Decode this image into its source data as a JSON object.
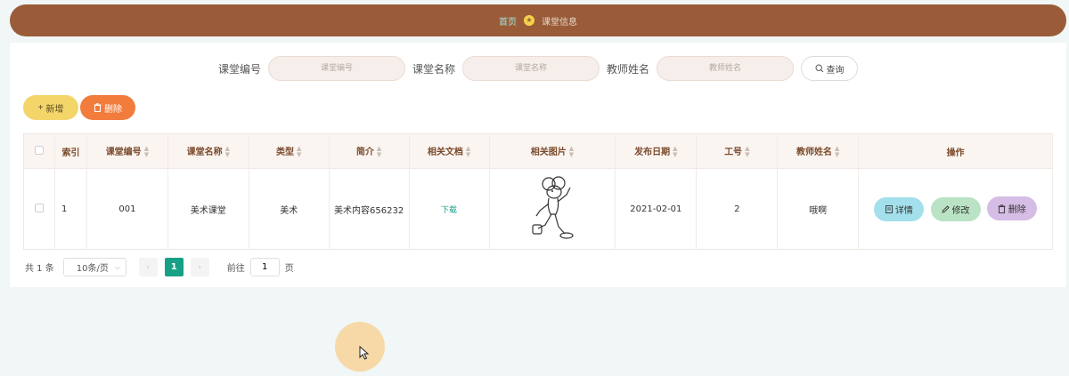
{
  "breadcrumb": {
    "home": "首页",
    "current": "课堂信息"
  },
  "search": {
    "fields": [
      {
        "label": "课堂编号",
        "placeholder": "课堂编号"
      },
      {
        "label": "课堂名称",
        "placeholder": "课堂名称"
      },
      {
        "label": "教师姓名",
        "placeholder": "教师姓名"
      }
    ],
    "query_label": "查询"
  },
  "toolbar": {
    "add_label": "新增",
    "delete_label": "删除"
  },
  "table": {
    "columns": [
      "索引",
      "课堂编号",
      "课堂名称",
      "类型",
      "简介",
      "相关文档",
      "相关图片",
      "发布日期",
      "工号",
      "教师姓名",
      "操作"
    ],
    "rows": [
      {
        "index": "1",
        "code": "001",
        "name": "美术课堂",
        "type": "美术",
        "intro": "美术内容656232",
        "doc": "下载",
        "date": "2021-02-01",
        "staff_no": "2",
        "teacher": "哦啊"
      }
    ],
    "actions": {
      "detail": "详情",
      "edit": "修改",
      "delete": "删除"
    }
  },
  "pagination": {
    "total": "共 1 条",
    "page_size": "10条/页",
    "current_page": "1",
    "goto_prefix": "前往",
    "goto_value": "1",
    "goto_suffix": "页"
  },
  "colors": {
    "header": "#9a5c38",
    "accent": "#17a085",
    "add": "#f4d56a",
    "delete": "#f27c3c"
  }
}
